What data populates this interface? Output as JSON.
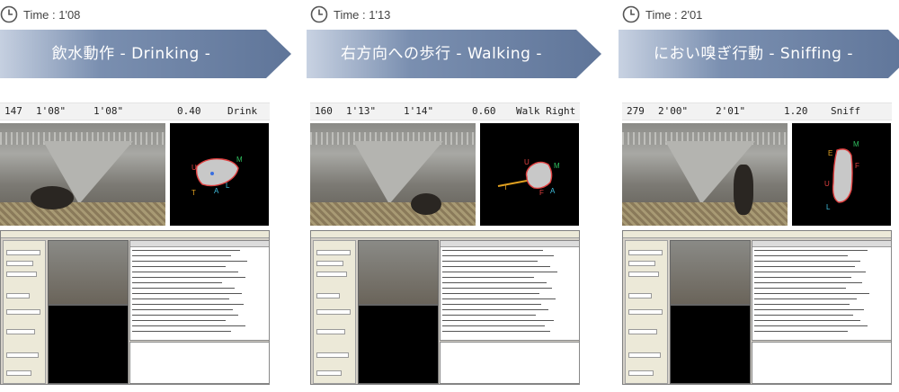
{
  "panels": [
    {
      "time": "Time : 1'08",
      "banner": "飲水動作 - Drinking -",
      "info": {
        "frame": "147",
        "start": "1'08\"",
        "end": "1'08\"",
        "length": "0.40",
        "behavior": "Drink"
      },
      "parts": [
        "U",
        "M",
        "T",
        "A",
        "L"
      ]
    },
    {
      "time": "Time : 1'13",
      "banner": "右方向への歩行 - Walking -",
      "info": {
        "frame": "160",
        "start": "1'13\"",
        "end": "1'14\"",
        "length": "0.60",
        "behavior": "Walk Right"
      },
      "parts": [
        "U",
        "M",
        "T",
        "F",
        "A"
      ]
    },
    {
      "time": "Time : 2'01",
      "banner": "におい嗅ぎ行動 - Sniffing -",
      "info": {
        "frame": "279",
        "start": "2'00\"",
        "end": "2'01\"",
        "length": "1.20",
        "behavior": "Sniff"
      },
      "parts": [
        "M",
        "E",
        "F",
        "U",
        "L"
      ]
    }
  ],
  "colors": {
    "banner": "#7a8fb0",
    "banner_dark": "#5f7599",
    "text": "#444444"
  }
}
